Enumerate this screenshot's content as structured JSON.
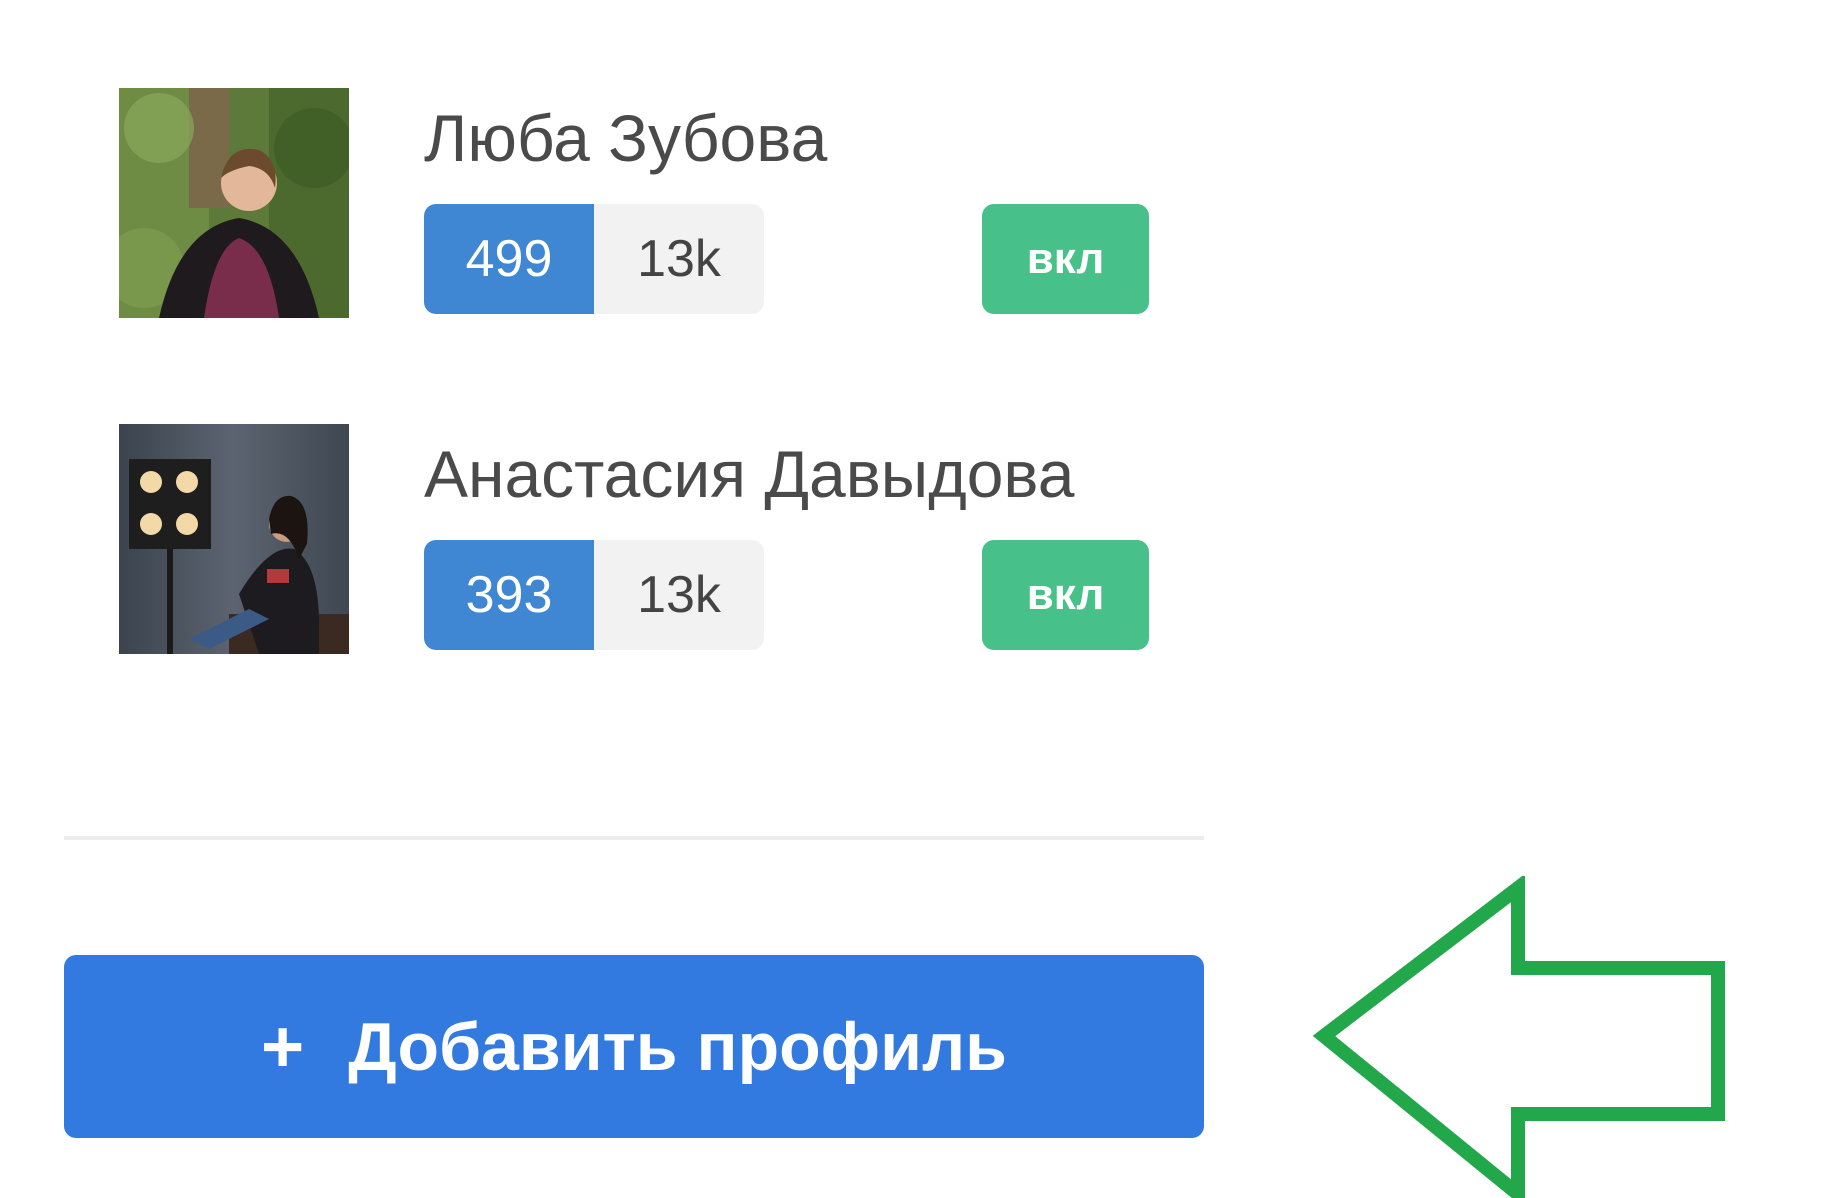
{
  "profiles": [
    {
      "name": "Люба Зубова",
      "count_primary": "499",
      "count_secondary": "13k",
      "toggle_label": "вкл",
      "colors": {
        "primary": "#3f86d3",
        "secondary": "#f2f2f2",
        "toggle": "#47c189"
      }
    },
    {
      "name": "Анастасия Давыдова",
      "count_primary": "393",
      "count_secondary": "13k",
      "toggle_label": "вкл",
      "colors": {
        "primary": "#3f86d3",
        "secondary": "#f2f2f2",
        "toggle": "#47c189"
      }
    }
  ],
  "add_button": {
    "icon": "plus-icon",
    "label": "Добавить профиль",
    "color": "#3279e0"
  },
  "annotation": {
    "icon": "left-arrow-outline-icon",
    "color": "#22a84a"
  }
}
